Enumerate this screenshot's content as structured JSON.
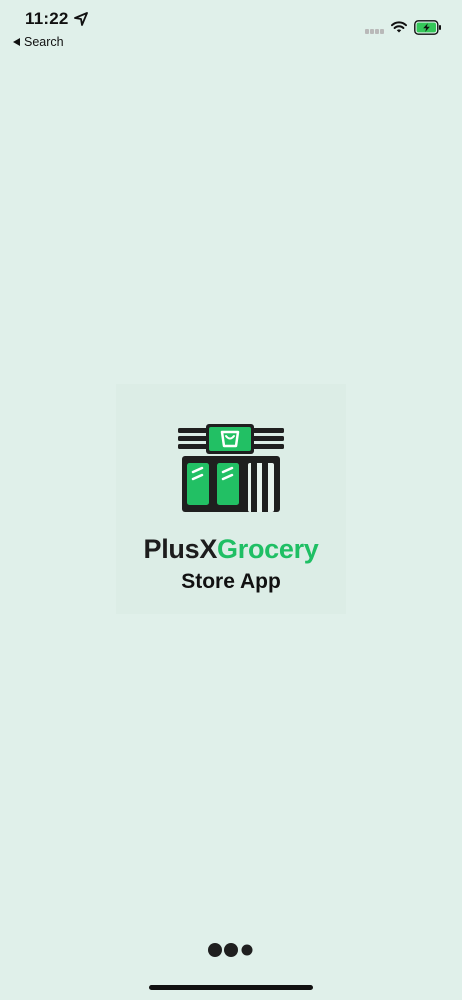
{
  "status_bar": {
    "time": "11:22",
    "back_label": "Search",
    "location_icon": "location-arrow-icon",
    "signal_icon": "cellular-signal-icon",
    "wifi_icon": "wifi-icon",
    "battery_icon": "battery-charging-icon",
    "battery_color": "#34c759"
  },
  "splash": {
    "logo_icon": "grocery-store-icon",
    "brand_part1": "PlusX",
    "brand_part2": "Grocery",
    "subtitle": "Store App",
    "brand_dark_color": "#1d1d1d",
    "brand_accent_color": "#1fbf64"
  },
  "loading": {
    "indicator": "loading-dots-icon"
  },
  "colors": {
    "background": "#e0f0ea",
    "card_background": "#dcede6"
  }
}
